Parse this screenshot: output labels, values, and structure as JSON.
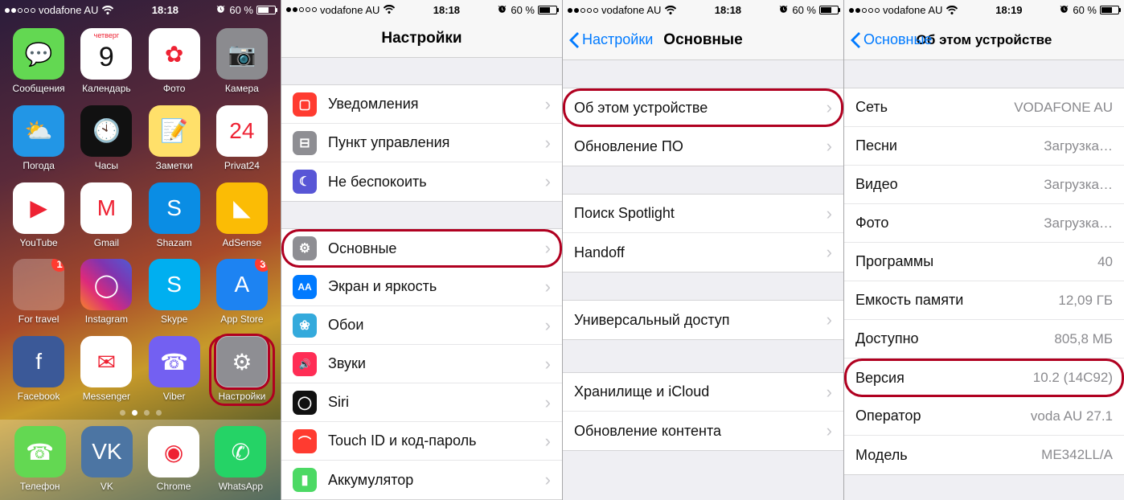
{
  "status": {
    "carrier": "vodafone AU",
    "time_1": "18:18",
    "time_4": "18:19",
    "battery_pct": "60 %",
    "signal_strength": 2
  },
  "panel1": {
    "apps": [
      {
        "label": "Сообщения",
        "key": "messages",
        "bg": "#63d852",
        "glyph": "💬"
      },
      {
        "label": "Календарь",
        "key": "calendar",
        "bg": "#ffffff",
        "glyph": "9",
        "top": "четверг"
      },
      {
        "label": "Фото",
        "key": "photos",
        "bg": "#ffffff",
        "glyph": "✿"
      },
      {
        "label": "Камера",
        "key": "camera",
        "bg": "#8b8b8f",
        "glyph": "📷"
      },
      {
        "label": "Погода",
        "key": "weather",
        "bg": "#2296e6",
        "glyph": "⛅"
      },
      {
        "label": "Часы",
        "key": "clock",
        "bg": "#111111",
        "glyph": "🕙"
      },
      {
        "label": "Заметки",
        "key": "notes",
        "bg": "#ffe06a",
        "glyph": "📝"
      },
      {
        "label": "Privat24",
        "key": "privat24",
        "bg": "#ffffff",
        "glyph": "24"
      },
      {
        "label": "YouTube",
        "key": "youtube",
        "bg": "#ffffff",
        "glyph": "▶"
      },
      {
        "label": "Gmail",
        "key": "gmail",
        "bg": "#ffffff",
        "glyph": "M"
      },
      {
        "label": "Shazam",
        "key": "shazam",
        "bg": "#0a8de4",
        "glyph": "S"
      },
      {
        "label": "AdSense",
        "key": "adsense",
        "bg": "#fbbc05",
        "glyph": "◣"
      },
      {
        "label": "For travel",
        "key": "folder-travel",
        "folder": true,
        "badge": "1"
      },
      {
        "label": "Instagram",
        "key": "instagram",
        "bg": "linear-gradient(45deg,#f58529,#dd2a7b,#8134af,#515bd4)",
        "glyph": "◯"
      },
      {
        "label": "Skype",
        "key": "skype",
        "bg": "#00aff0",
        "glyph": "S"
      },
      {
        "label": "App Store",
        "key": "appstore",
        "bg": "#1d83f2",
        "glyph": "A",
        "badge": "3"
      },
      {
        "label": "Facebook",
        "key": "facebook",
        "bg": "#3b5998",
        "glyph": "f"
      },
      {
        "label": "Messenger",
        "key": "messenger",
        "bg": "#ffffff",
        "glyph": "✉"
      },
      {
        "label": "Viber",
        "key": "viber",
        "bg": "#7360f2",
        "glyph": "☎"
      },
      {
        "label": "Настройки",
        "key": "settings",
        "bg": "#8e8e93",
        "glyph": "⚙",
        "hi": true
      }
    ],
    "dock": [
      {
        "label": "Телефон",
        "key": "phone",
        "bg": "#63d852",
        "glyph": "☎"
      },
      {
        "label": "VK",
        "key": "vk",
        "bg": "#4c75a3",
        "glyph": "VK"
      },
      {
        "label": "Chrome",
        "key": "chrome",
        "bg": "#ffffff",
        "glyph": "◉"
      },
      {
        "label": "WhatsApp",
        "key": "whatsapp",
        "bg": "#25d366",
        "glyph": "✆"
      }
    ]
  },
  "panel2": {
    "title": "Настройки",
    "groups": [
      [
        {
          "label": "Уведомления",
          "cls": "ic-red",
          "glyph": "▢"
        },
        {
          "label": "Пункт управления",
          "cls": "ic-grey",
          "glyph": "⊟"
        },
        {
          "label": "Не беспокоить",
          "cls": "ic-purple",
          "glyph": "☾"
        }
      ],
      [
        {
          "label": "Основные",
          "cls": "ic-grey",
          "glyph": "⚙",
          "hi": true
        },
        {
          "label": "Экран и яркость",
          "cls": "ic-blue",
          "glyph": "AA"
        },
        {
          "label": "Обои",
          "cls": "ic-teal",
          "glyph": "❀"
        },
        {
          "label": "Звуки",
          "cls": "ic-pink",
          "glyph": "🔊"
        },
        {
          "label": "Siri",
          "cls": "ic-black",
          "glyph": "◯"
        },
        {
          "label": "Touch ID и код-пароль",
          "cls": "ic-red",
          "glyph": "⌒"
        },
        {
          "label": "Аккумулятор",
          "cls": "ic-green",
          "glyph": "▮"
        }
      ]
    ]
  },
  "panel3": {
    "back": "Настройки",
    "title": "Основные",
    "groups": [
      [
        {
          "label": "Об этом устройстве",
          "hi": true
        },
        {
          "label": "Обновление ПО"
        }
      ],
      [
        {
          "label": "Поиск Spotlight"
        },
        {
          "label": "Handoff"
        }
      ],
      [
        {
          "label": "Универсальный доступ"
        }
      ],
      [
        {
          "label": "Хранилище и iCloud"
        },
        {
          "label": "Обновление контента"
        }
      ]
    ]
  },
  "panel4": {
    "back": "Основные",
    "title": "Об этом устройстве",
    "rows": [
      {
        "label": "Сеть",
        "value": "VODAFONE AU"
      },
      {
        "label": "Песни",
        "value": "Загрузка…"
      },
      {
        "label": "Видео",
        "value": "Загрузка…"
      },
      {
        "label": "Фото",
        "value": "Загрузка…"
      },
      {
        "label": "Программы",
        "value": "40"
      },
      {
        "label": "Емкость памяти",
        "value": "12,09 ГБ"
      },
      {
        "label": "Доступно",
        "value": "805,8 МБ"
      },
      {
        "label": "Версия",
        "value": "10.2 (14C92)",
        "hi": true
      },
      {
        "label": "Оператор",
        "value": "voda AU 27.1"
      },
      {
        "label": "Модель",
        "value": "ME342LL/A"
      }
    ]
  }
}
